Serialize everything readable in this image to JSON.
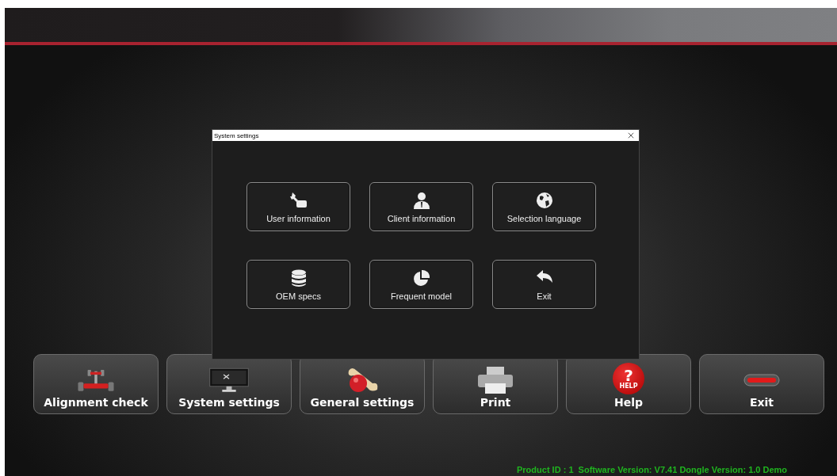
{
  "dialog": {
    "title": "System settings",
    "buttons": [
      {
        "label": "User information",
        "kind": "wrench"
      },
      {
        "label": "Client information",
        "kind": "person"
      },
      {
        "label": "Selection language",
        "kind": "globe"
      },
      {
        "label": "OEM specs",
        "kind": "database"
      },
      {
        "label": "Frequent model",
        "kind": "pie"
      },
      {
        "label": "Exit",
        "kind": "back"
      }
    ]
  },
  "toolbar": [
    {
      "label": "Alignment check",
      "kind": "chassis"
    },
    {
      "label": "System settings",
      "kind": "monitor"
    },
    {
      "label": "General settings",
      "kind": "tools"
    },
    {
      "label": "Print",
      "kind": "printer"
    },
    {
      "label": "Help",
      "kind": "help",
      "badge": "?",
      "badge_caption": "HELP"
    },
    {
      "label": "Exit",
      "kind": "exit"
    }
  ],
  "status_bar": {
    "text": "Product ID : 1  Software Version: V7.41 Dongle Version: 1.0 Demo"
  }
}
